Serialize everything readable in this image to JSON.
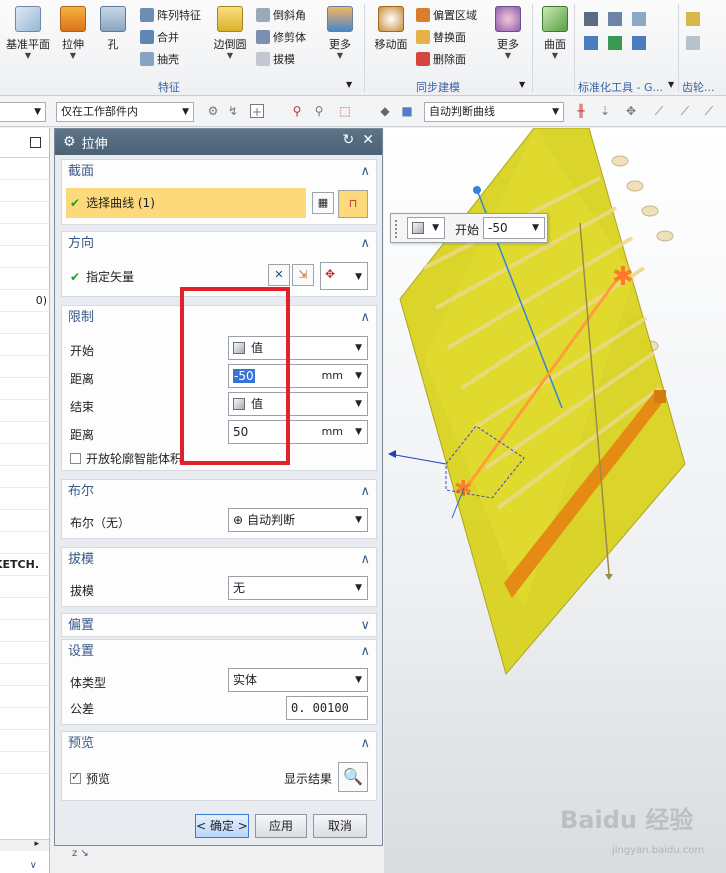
{
  "ribbon": {
    "buttons": [
      {
        "label": "基准平面",
        "icon": "datum-plane-icon"
      },
      {
        "label": "拉伸",
        "icon": "extrude-icon"
      },
      {
        "label": "孔",
        "icon": "hole-icon"
      },
      {
        "label": "边倒圆",
        "icon": "edge-blend-icon"
      },
      {
        "label": "更多",
        "icon": "more-icon"
      },
      {
        "label": "移动面",
        "icon": "move-face-icon"
      },
      {
        "label": "更多",
        "icon": "more-icon"
      },
      {
        "label": "曲面",
        "icon": "surface-icon"
      }
    ],
    "small_items": [
      "阵列特征",
      "合并",
      "抽壳",
      "倒斜角",
      "修剪体",
      "拔模",
      "偏置区域",
      "替换面",
      "删除面"
    ],
    "groups": [
      "特征",
      "同步建模",
      "标准化工具 - G...",
      "齿轮..."
    ]
  },
  "toolbar": {
    "filter_select": "",
    "scope_select": "仅在工作部件内",
    "curve_rule": "自动判断曲线"
  },
  "navigator": {
    "rows": [
      "",
      "",
      "",
      "",
      "",
      "",
      "0)",
      "",
      "",
      "",
      "",
      "",
      "",
      "",
      "",
      "",
      "",
      "",
      "KETCH.",
      "",
      "",
      "",
      "",
      "",
      "",
      "",
      "",
      ""
    ]
  },
  "dialog": {
    "title": "拉伸",
    "section": {
      "profile": "截面",
      "select_curve": "选择曲线 (1)",
      "direction": "方向",
      "specify_vector": "指定矢量",
      "limits": "限制",
      "start": "开始",
      "start_value": "值",
      "distance": "距离",
      "start_distance": "-50",
      "unit": "mm",
      "end": "结束",
      "end_value": "值",
      "end_distance": "50",
      "open_profile": "开放轮廓智能体积",
      "boolean": "布尔",
      "boolean_label": "布尔（无）",
      "boolean_value": "自动判断",
      "draft": "拔模",
      "draft_label": "拔模",
      "draft_value": "无",
      "offset": "偏置",
      "settings": "设置",
      "body_type": "体类型",
      "body_type_value": "实体",
      "tolerance": "公差",
      "tolerance_value": "0. 00100",
      "preview": "预览",
      "preview_cb": "预览",
      "show_result": "显示结果"
    },
    "buttons": {
      "ok": "< 确定 >",
      "apply": "应用",
      "cancel": "取消"
    }
  },
  "viewport_popup": {
    "label": "开始",
    "value": "-50"
  },
  "watermark": {
    "brand": "Baidu 经验",
    "url": "jingyan.baidu.com"
  },
  "colors": {
    "accent": "#3b5a86",
    "highlight": "#fcd97a",
    "model": "#d9d21a",
    "redbox": "#e0232a"
  }
}
